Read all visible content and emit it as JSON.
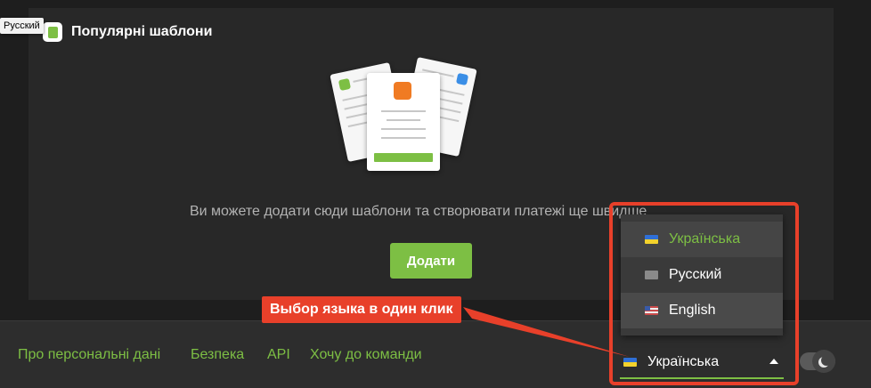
{
  "tooltip": {
    "text": "Русский"
  },
  "templates": {
    "title": "Популярні шаблони",
    "icon": "templates-icon",
    "empty_text": "Ви можете додати сюди шаблони та створювати платежі ще швидше",
    "add_label": "Додати"
  },
  "footer": {
    "links": [
      {
        "label": "Про персональні дані"
      },
      {
        "label": "Безпека"
      },
      {
        "label": "API"
      },
      {
        "label": "Хочу до команди"
      }
    ]
  },
  "callout": {
    "text": "Выбор языка в один клик"
  },
  "language": {
    "current": "Українська",
    "options": [
      {
        "label": "Українська",
        "flag": "ukraine-flag-icon",
        "selected": true
      },
      {
        "label": "Русский",
        "flag": "russia-flag-icon",
        "selected": false
      },
      {
        "label": "English",
        "flag": "usa-flag-icon",
        "selected": false
      }
    ]
  },
  "theme_toggle": {
    "icon": "moon-icon",
    "mode": "dark"
  },
  "colors": {
    "accent": "#7dbf44",
    "highlight": "#e8402a",
    "background": "#1e1e1e",
    "panel": "#282828"
  }
}
